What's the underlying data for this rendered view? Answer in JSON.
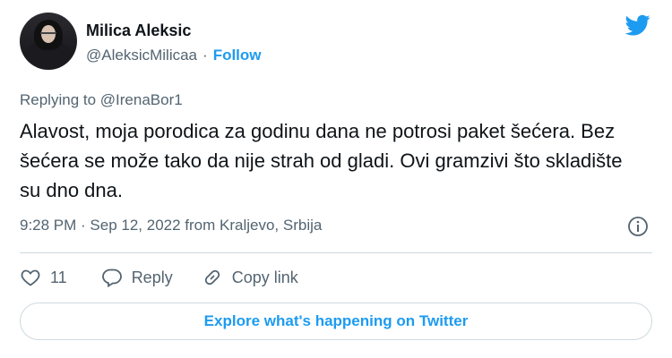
{
  "author": {
    "name": "Milica Aleksic",
    "handle": "@AleksicMilicaa",
    "separator": "·",
    "follow_label": "Follow"
  },
  "tweet": {
    "replying_to": "Replying to @IrenaBor1",
    "text": "Alavost, moja porodica za godinu dana ne potrosi paket šećera. Bez šećera se može tako da nije strah od gladi. Ovi gramzivi što skladište su dno dna.",
    "meta": "9:28 PM · Sep 12, 2022 from Kraljevo, Srbija"
  },
  "actions": {
    "like_count": "11",
    "reply_label": "Reply",
    "copy_link_label": "Copy link"
  },
  "explore_label": "Explore what's happening on Twitter",
  "colors": {
    "accent": "#1d9bf0",
    "text": "#0f1419",
    "muted": "#536471",
    "border": "#cfd9de"
  },
  "icons": [
    "twitter-bird-icon",
    "info-icon",
    "heart-icon",
    "reply-icon",
    "link-icon"
  ]
}
